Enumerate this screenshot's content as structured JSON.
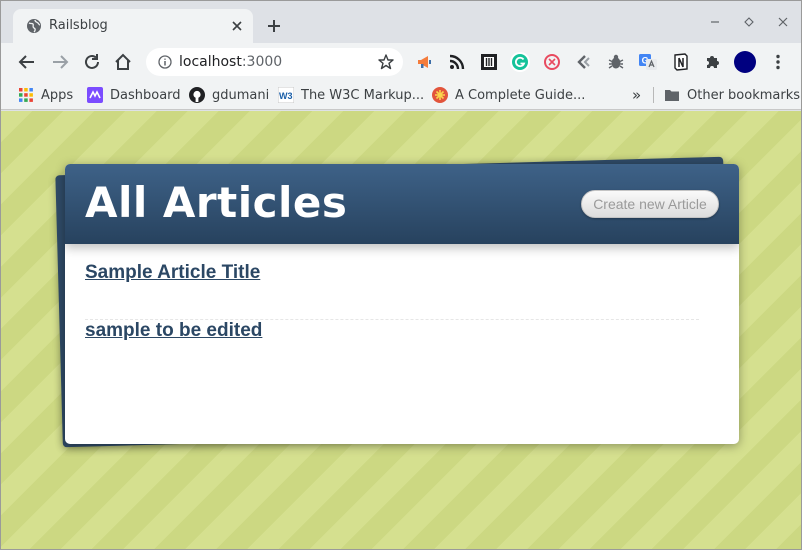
{
  "browser": {
    "tab": {
      "title": "Railsblog"
    },
    "window_controls": [
      "minimize",
      "maximize",
      "close"
    ],
    "address": {
      "host": "localhost",
      "port": ":3000"
    },
    "extensions": [
      "megaphone-icon",
      "rss-icon",
      "reader-icon",
      "grammarly-icon",
      "lastpass-icon",
      "back-arrow-ext-icon",
      "bug-icon",
      "translate-icon",
      "notion-icon",
      "puzzle-icon",
      "profile-avatar"
    ],
    "bookmarks": [
      {
        "label": "Apps",
        "icon": "apps-grid-icon"
      },
      {
        "label": "Dashboard",
        "icon": "dashboard-icon"
      },
      {
        "label": "gdumani",
        "icon": "github-icon"
      },
      {
        "label": "The W3C Markup...",
        "icon": "w3c-icon"
      },
      {
        "label": "A Complete Guide...",
        "icon": "css-tricks-icon"
      }
    ],
    "overflow": "»",
    "other_bookmarks": "Other bookmarks",
    "colors": {
      "tabstrip": "#dee1e6",
      "toolbar": "#f1f3f4"
    }
  },
  "page": {
    "title": "All Articles",
    "create_button": "Create new Article",
    "articles": [
      {
        "title": "Sample Article Title"
      },
      {
        "title": "sample to be edited"
      }
    ],
    "colors": {
      "header": "#2f4a66",
      "link": "#2b4764",
      "background": "#d5e08f"
    }
  }
}
